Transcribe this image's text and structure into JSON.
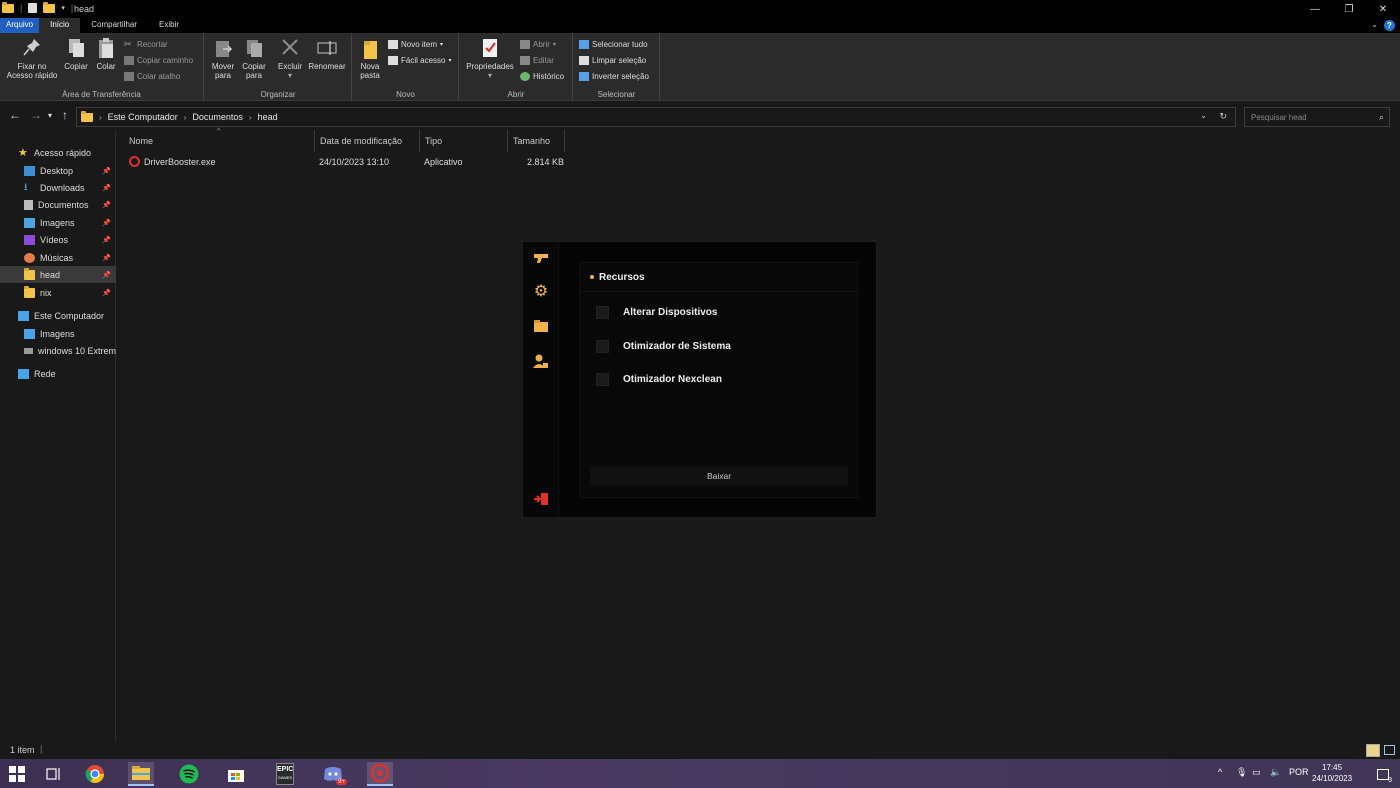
{
  "window": {
    "title": "head",
    "controls": {
      "minimize": "—",
      "maximize": "❐",
      "close": "✕"
    }
  },
  "ribbon_tabs": [
    "Arquivo",
    "Início",
    "Compartilhar",
    "Exibir"
  ],
  "ribbon": {
    "clipboard": {
      "label": "Área de Transferência",
      "pin_line1": "Fixar no",
      "pin_line2": "Acesso rápido",
      "copy": "Copiar",
      "paste": "Colar",
      "cut": "Recortar",
      "copy_path": "Copiar caminho",
      "paste_shortcut": "Colar atalho"
    },
    "organize": {
      "label": "Organizar",
      "move_l1": "Mover",
      "move_l2": "para",
      "copy_l1": "Copiar",
      "copy_l2": "para",
      "delete": "Excluir",
      "rename": "Renomear"
    },
    "new": {
      "label": "Novo",
      "folder_l1": "Nova",
      "folder_l2": "pasta",
      "new_item": "Novo item",
      "easy_access": "Fácil acesso"
    },
    "open": {
      "label": "Abrir",
      "properties": "Propriedades",
      "open": "Abrir",
      "edit": "Editar",
      "history": "Histórico"
    },
    "select": {
      "label": "Selecionar",
      "select_all": "Selecionar tudo",
      "clear": "Limpar seleção",
      "invert": "Inverter seleção"
    }
  },
  "address": {
    "crumbs": [
      "Este Computador",
      "Documentos",
      "head"
    ],
    "search_placeholder": "Pesquisar head"
  },
  "nav": {
    "quick_access": "Acesso rápido",
    "items": [
      "Desktop",
      "Downloads",
      "Documentos",
      "Imagens",
      "Vídeos",
      "Músicas",
      "head",
      "nix"
    ],
    "this_pc": "Este Computador",
    "pc_items": [
      "Imagens",
      "windows 10 Extrem"
    ],
    "network": "Rede"
  },
  "columns": {
    "name": "Nome",
    "date": "Data de modificação",
    "type": "Tipo",
    "size": "Tamanho"
  },
  "files": [
    {
      "name": "DriverBooster.exe",
      "date": "24/10/2023 13:10",
      "type": "Aplicativo",
      "size": "2.814 KB"
    }
  ],
  "status": {
    "count": "1 item"
  },
  "app": {
    "section": "Recursos",
    "features": [
      "Alterar Dispositivos",
      "Otimizador de Sistema",
      "Otimizador Nexclean"
    ],
    "button": "Baixar",
    "accent": "#f0b14a",
    "exit_color": "#e0312a"
  },
  "taskbar": {
    "lang": "POR",
    "time": "17:45",
    "date": "24/10/2023",
    "epic_l1": "EPIC",
    "epic_l2": "GAMES",
    "discord_badge": "9+",
    "notif_count": "3"
  }
}
